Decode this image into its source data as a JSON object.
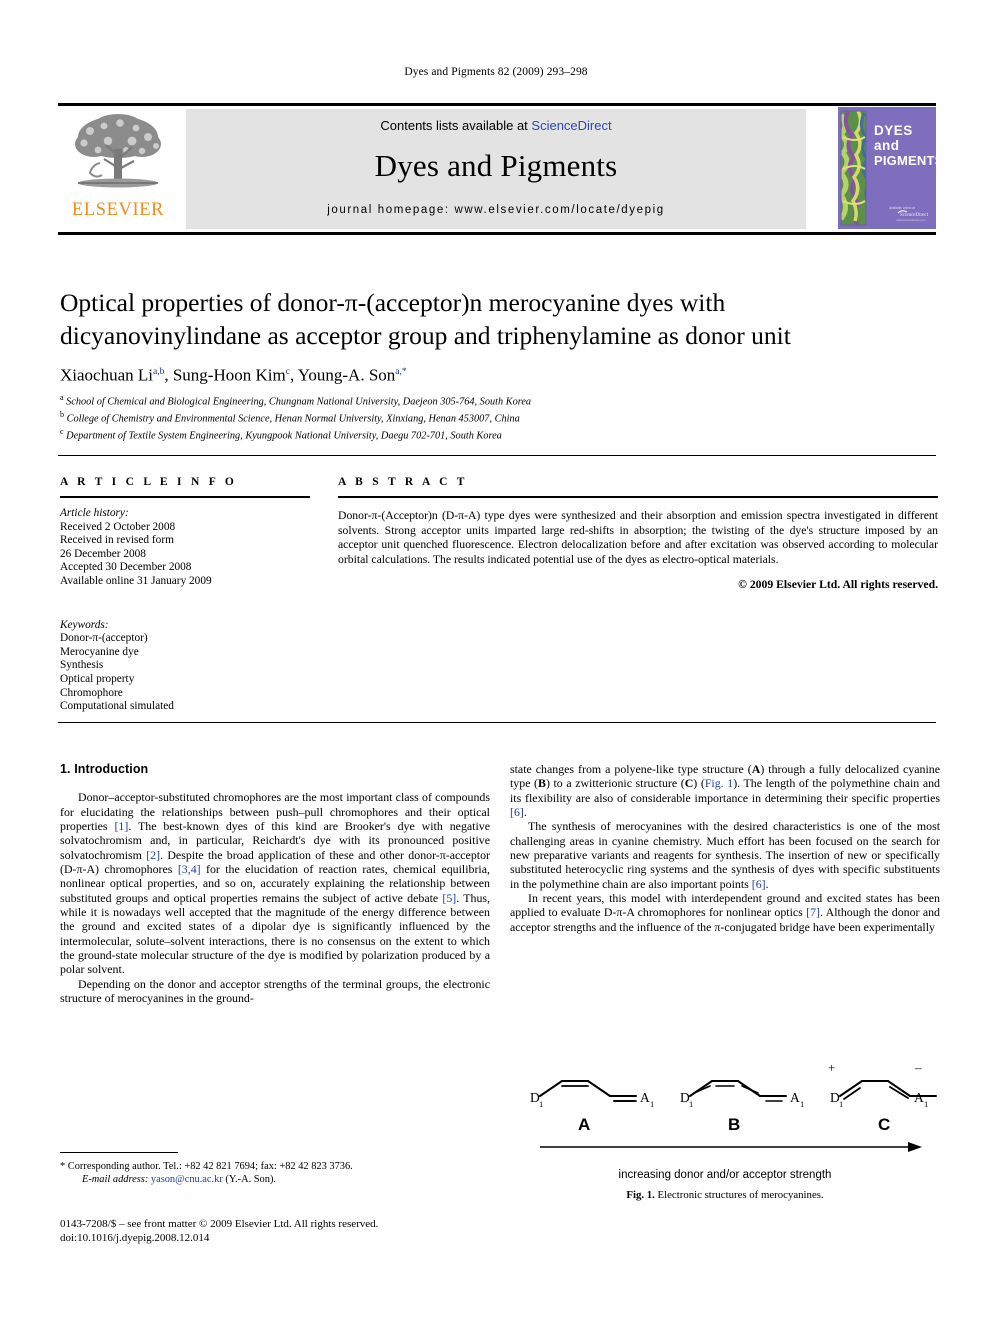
{
  "running_head": "Dyes and Pigments 82 (2009) 293–298",
  "masthead": {
    "contents_prefix": "Contents lists available at ",
    "sciencedirect": "ScienceDirect",
    "journal_name": "Dyes and Pigments",
    "homepage": "journal homepage: www.elsevier.com/locate/dyepig",
    "publisher_logo_text": "ELSEVIER",
    "publisher_logo_icon": "elsevier-tree-icon",
    "cover_title_line1": "DYES",
    "cover_title_line2": "and",
    "cover_title_line3": "PIGMENTS",
    "cover_bg_color": "#7d6fbe",
    "accent_link_color": "#2b49b5",
    "elsevier_orange": "#F08C1B"
  },
  "article": {
    "title_line1": "Optical properties of donor-π-(acceptor)n merocyanine dyes with",
    "title_line2": "dicyanovinylindane as acceptor group and triphenylamine as donor unit",
    "authors": "Xiaochuan Li a,b, Sung-Hoon Kim c, Young-A. Son a,*",
    "affiliations": [
      "a School of Chemical and Biological Engineering, Chungnam National University, Daejeon 305-764, South Korea",
      "b College of Chemistry and Environmental Science, Henan Normal University, Xinxiang, Henan 453007, China",
      "c Department of Textile System Engineering, Kyungpook National University, Daegu 702-701, South Korea"
    ]
  },
  "article_info": {
    "heading": "A R T I C L E   I N F O",
    "history_label": "Article history:",
    "history": [
      "Received 2 October 2008",
      "Received in revised form",
      "26 December 2008",
      "Accepted 30 December 2008",
      "Available online 31 January 2009"
    ],
    "keywords_label": "Keywords:",
    "keywords": [
      "Donor-π-(acceptor)",
      "Merocyanine dye",
      "Synthesis",
      "Optical property",
      "Chromophore",
      "Computational simulated"
    ]
  },
  "abstract": {
    "heading": "A B S T R A C T",
    "text": "Donor-π-(Acceptor)n (D-π-A) type dyes were synthesized and their absorption and emission spectra investigated in different solvents. Strong acceptor units imparted large red-shifts in absorption; the twisting of the dye's structure imposed by an acceptor unit quenched fluorescence. Electron delocalization before and after excitation was observed according to molecular orbital calculations. The results indicated potential use of the dyes as electro-optical materials.",
    "copyright": "© 2009 Elsevier Ltd. All rights reserved."
  },
  "body": {
    "section_heading": "1. Introduction",
    "left_paragraphs": [
      "Donor–acceptor-substituted chromophores are the most important class of compounds for elucidating the relationships between push–pull chromophores and their optical properties [1]. The best-known dyes of this kind are Brooker's dye with negative solvatochromism and, in particular, Reichardt's dye with its pronounced positive solvatochromism [2]. Despite the broad application of these and other donor-π-acceptor (D-π-A) chromophores [3,4] for the elucidation of reaction rates, chemical equilibria, nonlinear optical properties, and so on, accurately explaining the relationship between substituted groups and optical properties remains the subject of active debate [5]. Thus, while it is nowadays well accepted that the magnitude of the energy difference between the ground and excited states of a dipolar dye is significantly influenced by the intermolecular, solute–solvent interactions, there is no consensus on the extent to which the ground-state molecular structure of the dye is modified by polarization produced by a polar solvent.",
      "Depending on the donor and acceptor strengths of the terminal groups, the electronic structure of merocyanines in the ground-"
    ],
    "right_paragraphs": [
      "state changes from a polyene-like type structure (A) through a fully delocalized cyanine type (B) to a zwitterionic structure (C) (Fig. 1). The length of the polymethine chain and its flexibility are also of considerable importance in determining their specific properties [6].",
      "The synthesis of merocyanines with the desired characteristics is one of the most challenging areas in cyanine chemistry. Much effort has been focused on the search for new preparative variants and reagents for synthesis. The insertion of new or specifically substituted heterocyclic ring systems and the synthesis of dyes with specific substituents in the polymethine chain are also important points [6].",
      "In recent years, this model with interdependent ground and excited states has been applied to evaluate D-π-A chromophores for nonlinear optics [7]. Although the donor and acceptor strengths and the influence of the π-conjugated bridge have been experimentally"
    ]
  },
  "footnote": {
    "corresponding": "* Corresponding author. Tel.: +82 42 821 7694; fax: +82 42 823 3736.",
    "email_label": "E-mail address:",
    "email": "yason@cnu.ac.kr",
    "email_suffix": "(Y.-A. Son).",
    "frontmatter_line1": "0143-7208/$ – see front matter © 2009 Elsevier Ltd. All rights reserved.",
    "frontmatter_line2": "doi:10.1016/j.dyepig.2008.12.014"
  },
  "figure": {
    "label_a": "A",
    "label_b": "B",
    "label_c": "C",
    "donor_label": "D",
    "donor_sub": "1",
    "acceptor_label": "A",
    "acceptor_sub": "1",
    "plus_sign": "+",
    "minus_sign": "–",
    "arrow_caption": "increasing donor and/or acceptor strength",
    "caption_prefix": "Fig. 1.",
    "caption_text": "Electronic structures of merocyanines."
  }
}
